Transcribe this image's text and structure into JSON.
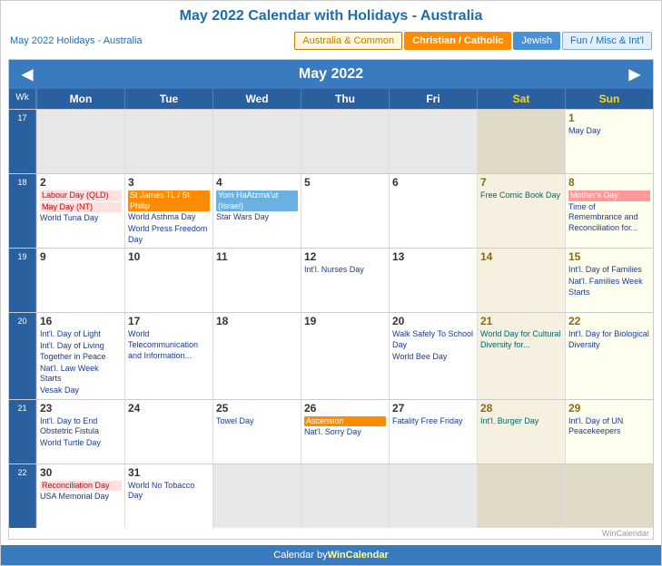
{
  "page": {
    "title": "May 2022 Calendar with Holidays - Australia",
    "subtitle": "May 2022 Holidays - Australia"
  },
  "tabs": [
    {
      "label": "Australia & Common",
      "class": "tab-australia"
    },
    {
      "label": "Christian / Catholic",
      "class": "tab-christian"
    },
    {
      "label": "Jewish",
      "class": "tab-jewish"
    },
    {
      "label": "Fun / Misc & Int'l",
      "class": "tab-fun"
    }
  ],
  "calendar": {
    "nav_title": "May 2022",
    "headers": [
      "Mon",
      "Tue",
      "Wed",
      "Thu",
      "Fri",
      "Sat",
      "Sun"
    ],
    "week_label": "Wk"
  },
  "footer": {
    "text": "Calendar by ",
    "link_text": "WinCalendar",
    "watermark": "WinCalendar"
  }
}
